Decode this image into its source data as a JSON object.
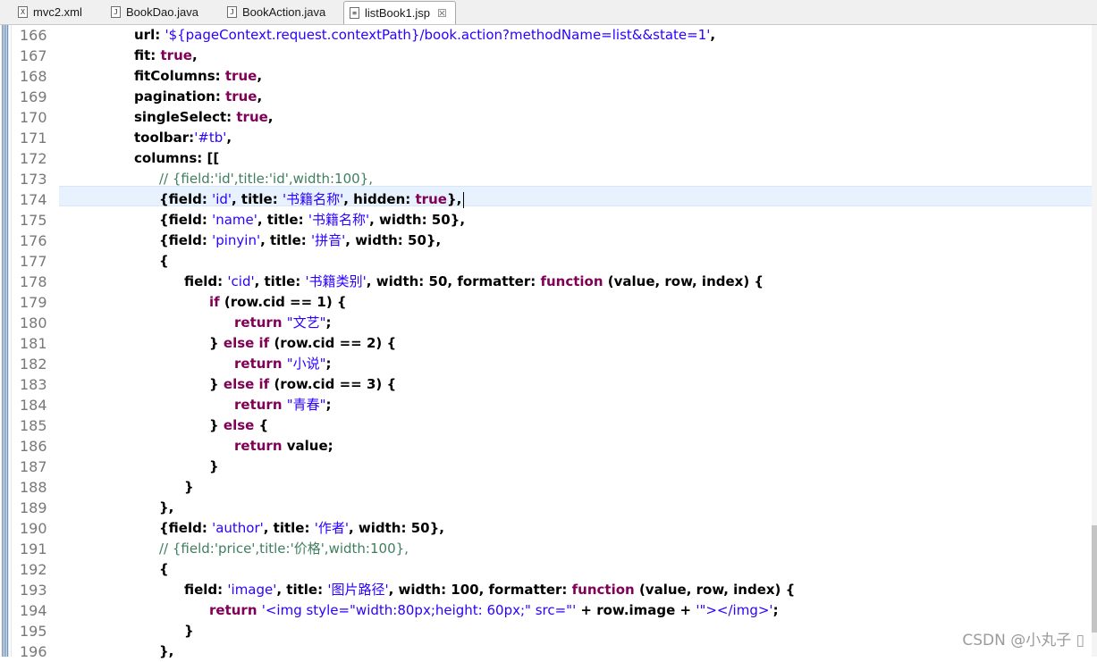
{
  "tabs": [
    {
      "label": "mvc2.xml",
      "icon": "xml-file-icon",
      "glyph": "X"
    },
    {
      "label": "BookDao.java",
      "icon": "java-file-icon",
      "glyph": "J"
    },
    {
      "label": "BookAction.java",
      "icon": "java-file-icon",
      "glyph": "J"
    },
    {
      "label": "listBook1.jsp",
      "icon": "jsp-file-icon",
      "glyph": "≡",
      "close": "☒"
    }
  ],
  "lines": [
    {
      "n": "166",
      "t": [
        [
          "p",
          "url: "
        ],
        [
          "s",
          "'${pageContext.request.contextPath}/book.action?methodName=list&&state=1'"
        ],
        [
          "p",
          ","
        ]
      ]
    },
    {
      "n": "167",
      "t": [
        [
          "p",
          "fit: "
        ],
        [
          "k",
          "true"
        ],
        [
          "p",
          ","
        ]
      ]
    },
    {
      "n": "168",
      "t": [
        [
          "p",
          "fitColumns: "
        ],
        [
          "k",
          "true"
        ],
        [
          "p",
          ","
        ]
      ]
    },
    {
      "n": "169",
      "t": [
        [
          "p",
          "pagination: "
        ],
        [
          "k",
          "true"
        ],
        [
          "p",
          ","
        ]
      ]
    },
    {
      "n": "170",
      "t": [
        [
          "p",
          "singleSelect: "
        ],
        [
          "k",
          "true"
        ],
        [
          "p",
          ","
        ]
      ]
    },
    {
      "n": "171",
      "t": [
        [
          "p",
          "toolbar:"
        ],
        [
          "s",
          "'#tb'"
        ],
        [
          "p",
          ","
        ]
      ]
    },
    {
      "n": "172",
      "t": [
        [
          "p",
          "columns: [["
        ]
      ]
    },
    {
      "n": "173",
      "t": [
        [
          "c",
          "// {field:'id',title:'id',width:100},"
        ]
      ]
    },
    {
      "n": "174",
      "t": [
        [
          "p",
          "{field: "
        ],
        [
          "s",
          "'id'"
        ],
        [
          "p",
          ", title: "
        ],
        [
          "s",
          "'书籍名称'"
        ],
        [
          "p",
          ", hidden: "
        ],
        [
          "k",
          "true"
        ],
        [
          "p",
          "},"
        ]
      ]
    },
    {
      "n": "175",
      "t": [
        [
          "p",
          "{field: "
        ],
        [
          "s",
          "'name'"
        ],
        [
          "p",
          ", title: "
        ],
        [
          "s",
          "'书籍名称'"
        ],
        [
          "p",
          ", width: 50},"
        ]
      ]
    },
    {
      "n": "176",
      "t": [
        [
          "p",
          "{field: "
        ],
        [
          "s",
          "'pinyin'"
        ],
        [
          "p",
          ", title: "
        ],
        [
          "s",
          "'拼音'"
        ],
        [
          "p",
          ", width: 50},"
        ]
      ]
    },
    {
      "n": "177",
      "t": [
        [
          "p",
          "{"
        ]
      ]
    },
    {
      "n": "178",
      "t": [
        [
          "p",
          "field: "
        ],
        [
          "s",
          "'cid'"
        ],
        [
          "p",
          ", title: "
        ],
        [
          "s",
          "'书籍类别'"
        ],
        [
          "p",
          ", width: 50, formatter: "
        ],
        [
          "k",
          "function"
        ],
        [
          "p",
          " (value, row, index) {"
        ]
      ]
    },
    {
      "n": "179",
      "t": [
        [
          "k",
          "if"
        ],
        [
          "p",
          " (row.cid == 1) {"
        ]
      ]
    },
    {
      "n": "180",
      "t": [
        [
          "k",
          "return"
        ],
        [
          "p",
          " "
        ],
        [
          "s",
          "\"文艺\""
        ],
        [
          "p",
          ";"
        ]
      ]
    },
    {
      "n": "181",
      "t": [
        [
          "p",
          "} "
        ],
        [
          "k",
          "else if"
        ],
        [
          "p",
          " (row.cid == 2) {"
        ]
      ]
    },
    {
      "n": "182",
      "t": [
        [
          "k",
          "return"
        ],
        [
          "p",
          " "
        ],
        [
          "s",
          "\"小说\""
        ],
        [
          "p",
          ";"
        ]
      ]
    },
    {
      "n": "183",
      "t": [
        [
          "p",
          "} "
        ],
        [
          "k",
          "else if"
        ],
        [
          "p",
          " (row.cid == 3) {"
        ]
      ]
    },
    {
      "n": "184",
      "t": [
        [
          "k",
          "return"
        ],
        [
          "p",
          " "
        ],
        [
          "s",
          "\"青春\""
        ],
        [
          "p",
          ";"
        ]
      ]
    },
    {
      "n": "185",
      "t": [
        [
          "p",
          "} "
        ],
        [
          "k",
          "else"
        ],
        [
          "p",
          " {"
        ]
      ]
    },
    {
      "n": "186",
      "t": [
        [
          "k",
          "return"
        ],
        [
          "p",
          " value;"
        ]
      ]
    },
    {
      "n": "187",
      "t": [
        [
          "p",
          "}"
        ]
      ]
    },
    {
      "n": "188",
      "t": [
        [
          "p",
          "}"
        ]
      ]
    },
    {
      "n": "189",
      "t": [
        [
          "p",
          "},"
        ]
      ]
    },
    {
      "n": "190",
      "t": [
        [
          "p",
          "{field: "
        ],
        [
          "s",
          "'author'"
        ],
        [
          "p",
          ", title: "
        ],
        [
          "s",
          "'作者'"
        ],
        [
          "p",
          ", width: 50},"
        ]
      ]
    },
    {
      "n": "191",
      "t": [
        [
          "c",
          "// {field:'price',title:'价格',width:100},"
        ]
      ]
    },
    {
      "n": "192",
      "t": [
        [
          "p",
          "{"
        ]
      ]
    },
    {
      "n": "193",
      "t": [
        [
          "p",
          "field: "
        ],
        [
          "s",
          "'image'"
        ],
        [
          "p",
          ", title: "
        ],
        [
          "s",
          "'图片路径'"
        ],
        [
          "p",
          ", width: 100, formatter: "
        ],
        [
          "k",
          "function"
        ],
        [
          "p",
          " (value, row, index) {"
        ]
      ]
    },
    {
      "n": "194",
      "t": [
        [
          "k",
          "return"
        ],
        [
          "p",
          " "
        ],
        [
          "s",
          "'<img style=\"width:80px;height: 60px;\" src=\"'"
        ],
        [
          "p",
          " + row.image + "
        ],
        [
          "s",
          "'\"></img>'"
        ],
        [
          "p",
          ";"
        ]
      ]
    },
    {
      "n": "195",
      "t": [
        [
          "p",
          "}"
        ]
      ]
    },
    {
      "n": "196",
      "t": [
        [
          "p",
          "},"
        ]
      ]
    }
  ],
  "watermark": "CSDN @小丸子 ▯"
}
